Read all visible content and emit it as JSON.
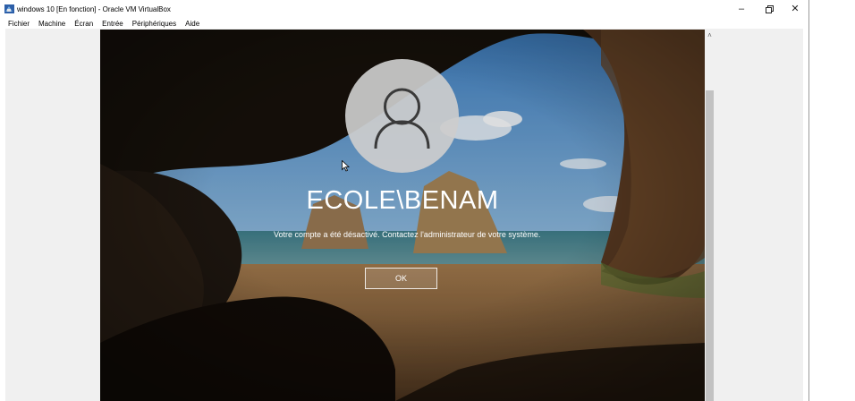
{
  "window": {
    "title": "windows 10 [En fonction] - Oracle VM VirtualBox",
    "controls": {
      "minimize": "–",
      "restore": "◘",
      "close": "✕"
    }
  },
  "menubar": {
    "items": [
      {
        "label": "Fichier"
      },
      {
        "label": "Machine"
      },
      {
        "label": "Écran"
      },
      {
        "label": "Entrée"
      },
      {
        "label": "Périphériques"
      },
      {
        "label": "Aide"
      }
    ]
  },
  "lockscreen": {
    "username": "ECOLE\\BENAM",
    "message": "Votre compte a été désactivé. Contactez l'administrateur de votre système.",
    "ok_label": "OK",
    "avatar_icon": "user-icon"
  },
  "scrollbar": {
    "up_arrow": "˄"
  },
  "colors": {
    "text_on_screen": "#ffffff",
    "avatar_bg": "#cdcdcd"
  }
}
